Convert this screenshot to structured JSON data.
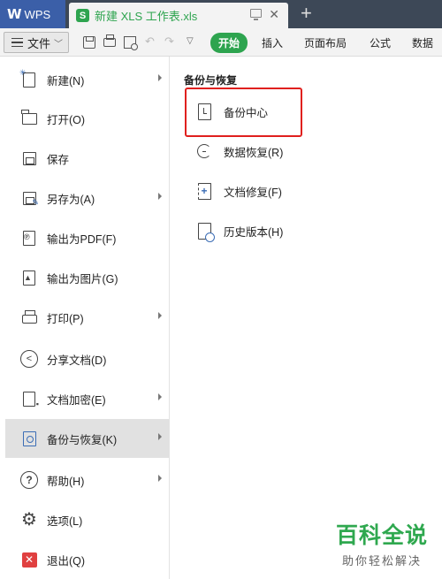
{
  "titlebar": {
    "app_tab": "WPS",
    "doc_tab": "新建 XLS 工作表.xls",
    "new_tab_symbol": "+"
  },
  "toolbar": {
    "file_label": "文件",
    "tabs": [
      {
        "label": "开始",
        "active": true
      },
      {
        "label": "插入",
        "active": false
      },
      {
        "label": "页面布局",
        "active": false
      },
      {
        "label": "公式",
        "active": false
      },
      {
        "label": "数据",
        "active": false
      }
    ]
  },
  "file_menu": {
    "items": [
      {
        "label": "新建(N)",
        "icon": "new-doc-icon",
        "has_submenu": true
      },
      {
        "label": "打开(O)",
        "icon": "open-folder-icon",
        "has_submenu": false
      },
      {
        "label": "保存",
        "icon": "save-icon",
        "has_submenu": false
      },
      {
        "label": "另存为(A)",
        "icon": "save-as-icon",
        "has_submenu": true
      },
      {
        "label": "输出为PDF(F)",
        "icon": "export-pdf-icon",
        "has_submenu": false
      },
      {
        "label": "输出为图片(G)",
        "icon": "export-image-icon",
        "has_submenu": false
      },
      {
        "label": "打印(P)",
        "icon": "print-icon",
        "has_submenu": true
      },
      {
        "label": "分享文档(D)",
        "icon": "share-icon",
        "has_submenu": false
      },
      {
        "label": "文档加密(E)",
        "icon": "encrypt-icon",
        "has_submenu": true
      },
      {
        "label": "备份与恢复(K)",
        "icon": "backup-icon",
        "has_submenu": true,
        "selected": true
      },
      {
        "label": "帮助(H)",
        "icon": "help-icon",
        "has_submenu": true
      },
      {
        "label": "选项(L)",
        "icon": "gear-icon",
        "has_submenu": false
      },
      {
        "label": "退出(Q)",
        "icon": "exit-icon",
        "has_submenu": false
      }
    ]
  },
  "submenu": {
    "title": "备份与恢复",
    "items": [
      {
        "label": "备份中心",
        "icon": "backup-center-icon",
        "highlighted": true
      },
      {
        "label": "数据恢复(R)",
        "icon": "data-recovery-icon"
      },
      {
        "label": "文档修复(F)",
        "icon": "document-repair-icon"
      },
      {
        "label": "历史版本(H)",
        "icon": "history-version-icon"
      }
    ]
  },
  "watermark": {
    "main": "百科全说",
    "sub": "助你轻松解决"
  },
  "colors": {
    "accent_green": "#2ea44f",
    "titlebar": "#3d4857",
    "wps_tab": "#3b5fa8",
    "highlight_red": "#e0201e"
  }
}
